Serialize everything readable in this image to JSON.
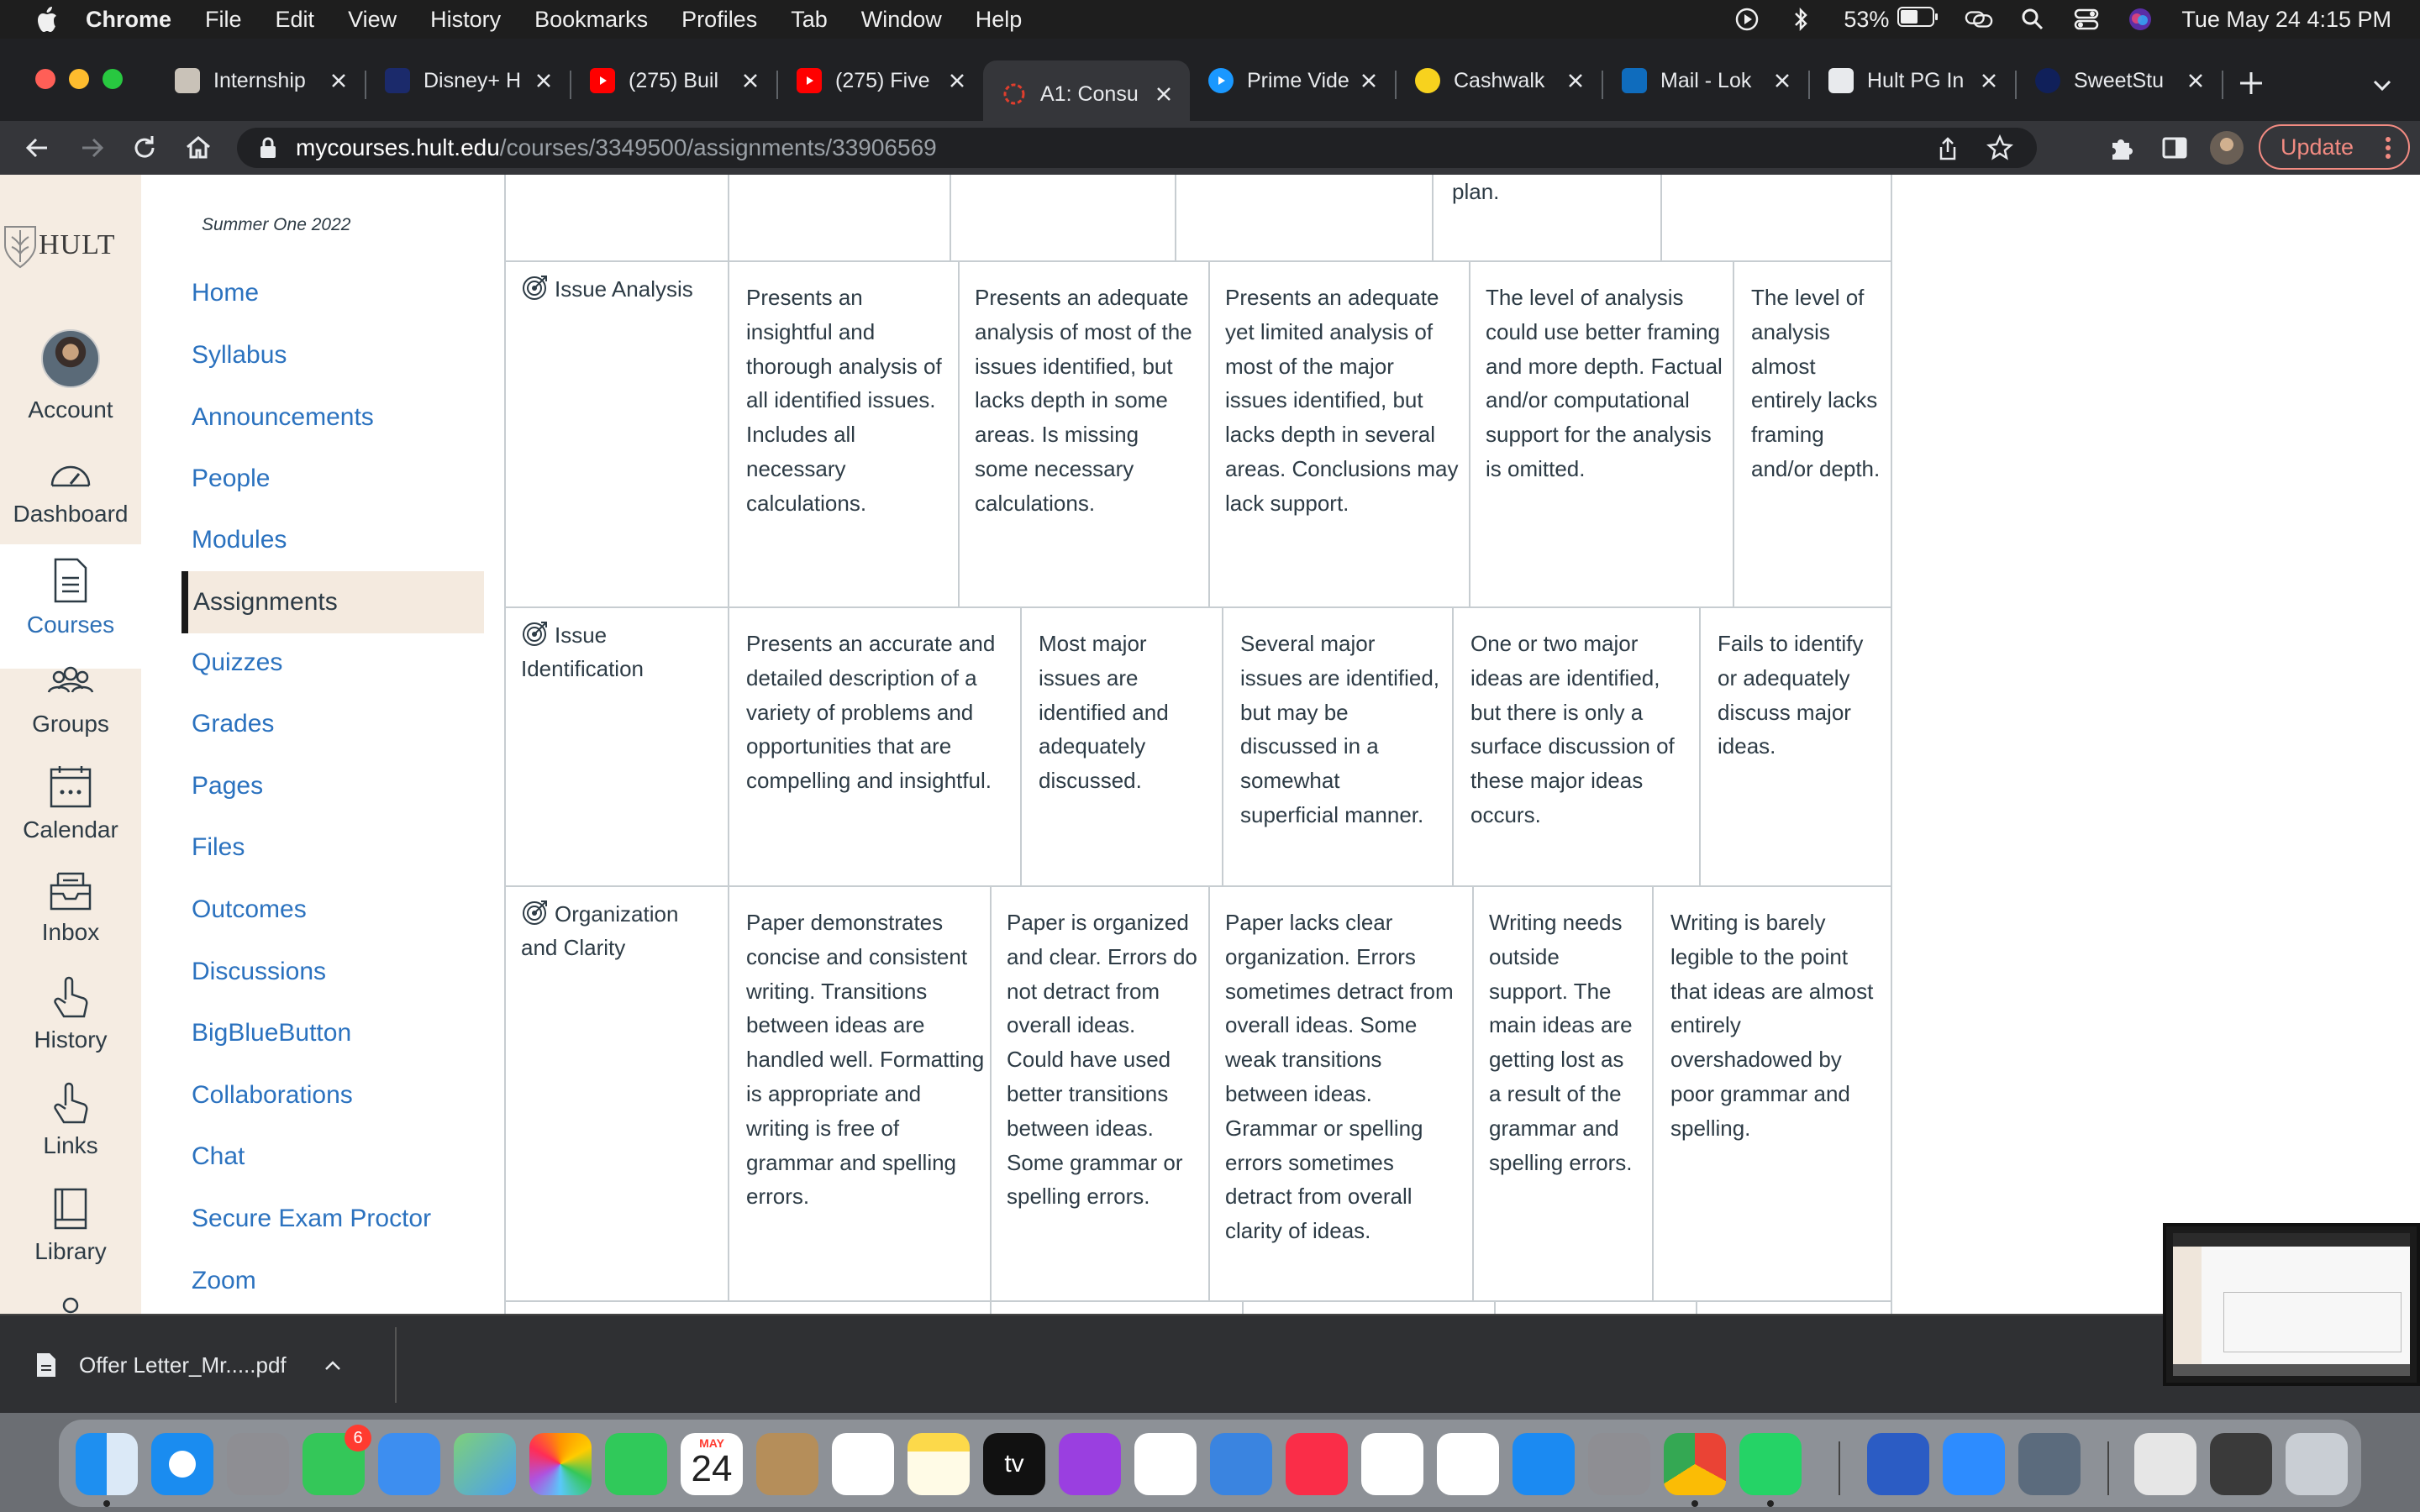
{
  "menubar": {
    "app": "Chrome",
    "menus": [
      "File",
      "Edit",
      "View",
      "History",
      "Bookmarks",
      "Profiles",
      "Tab",
      "Window",
      "Help"
    ],
    "battery": "53%",
    "clock": "Tue May 24  4:15 PM"
  },
  "tabs": [
    {
      "title": "Internship"
    },
    {
      "title": "Disney+ H"
    },
    {
      "title": "(275) Buil"
    },
    {
      "title": "(275) Five"
    },
    {
      "title": "A1: Consu"
    },
    {
      "title": "Prime Vide"
    },
    {
      "title": "Cashwalk"
    },
    {
      "title": "Mail - Lok"
    },
    {
      "title": "Hult PG In"
    },
    {
      "title": "SweetStu"
    }
  ],
  "address": {
    "host": "mycourses.hult.edu",
    "path": "/courses/3349500/assignments/33906569"
  },
  "toolbar": {
    "update_label": "Update"
  },
  "global_nav": {
    "logo": "HULT",
    "account": "Account",
    "dashboard": "Dashboard",
    "courses": "Courses",
    "groups": "Groups",
    "calendar": "Calendar",
    "inbox": "Inbox",
    "history": "History",
    "links": "Links",
    "library": "Library"
  },
  "course_nav": {
    "term": "Summer One 2022",
    "items": [
      "Home",
      "Syllabus",
      "Announcements",
      "People",
      "Modules",
      "Assignments",
      "Quizzes",
      "Grades",
      "Pages",
      "Files",
      "Outcomes",
      "Discussions",
      "BigBlueButton",
      "Collaborations",
      "Chat",
      "Secure Exam Proctor",
      "Zoom"
    ]
  },
  "rubric": {
    "top_fragment": "plan.",
    "rows": [
      {
        "criterion": "Issue Analysis",
        "ratings": [
          "Presents an insightful and thorough analysis of all identified issues. Includes all necessary calculations.",
          "Presents an adequate analysis of most of the issues identified, but lacks depth in some areas. Is missing some necessary calculations.",
          "Presents an adequate yet limited analysis of most of the major issues identified, but lacks depth in several areas. Conclusions may lack support.",
          "The level of analysis could use better framing and more depth. Factual and/or computational support for the analysis is omitted.",
          "The level of analysis almost entirely lacks framing and/or depth."
        ]
      },
      {
        "criterion": "Issue Identification",
        "ratings": [
          "Presents an accurate and detailed description of a variety of problems and opportunities that are compelling and insightful.",
          "Most major issues are identified and adequately discussed.",
          "Several major issues are identified, but may be discussed in a somewhat superficial manner.",
          "One or two major ideas are identified, but there is only a surface discussion of these major ideas occurs.",
          "Fails to identify or adequately discuss major ideas."
        ]
      },
      {
        "criterion": "Organization and Clarity",
        "ratings": [
          "Paper demonstrates concise and consistent writing. Transitions between ideas are handled well. Formatting is appropriate and writing is free of grammar and spelling errors.",
          "Paper is organized and clear. Errors do not detract from overall ideas. Could have used better transitions between ideas. Some grammar or spelling errors.",
          "Paper lacks clear organization. Errors sometimes detract from overall ideas. Some weak transitions between ideas. Grammar or spelling errors sometimes detract from overall clarity of ideas.",
          "Writing needs outside support. The main ideas are getting lost as a result of the grammar and spelling errors.",
          "Writing is barely legible to the point that ideas are almost entirely overshadowed by poor grammar and spelling."
        ]
      }
    ]
  },
  "downloads": {
    "file": "Offer Letter_Mr.....pdf"
  },
  "dock": {
    "messages_badge": "6",
    "calendar_month": "MAY",
    "calendar_day": "24",
    "tv_label": "tv"
  }
}
